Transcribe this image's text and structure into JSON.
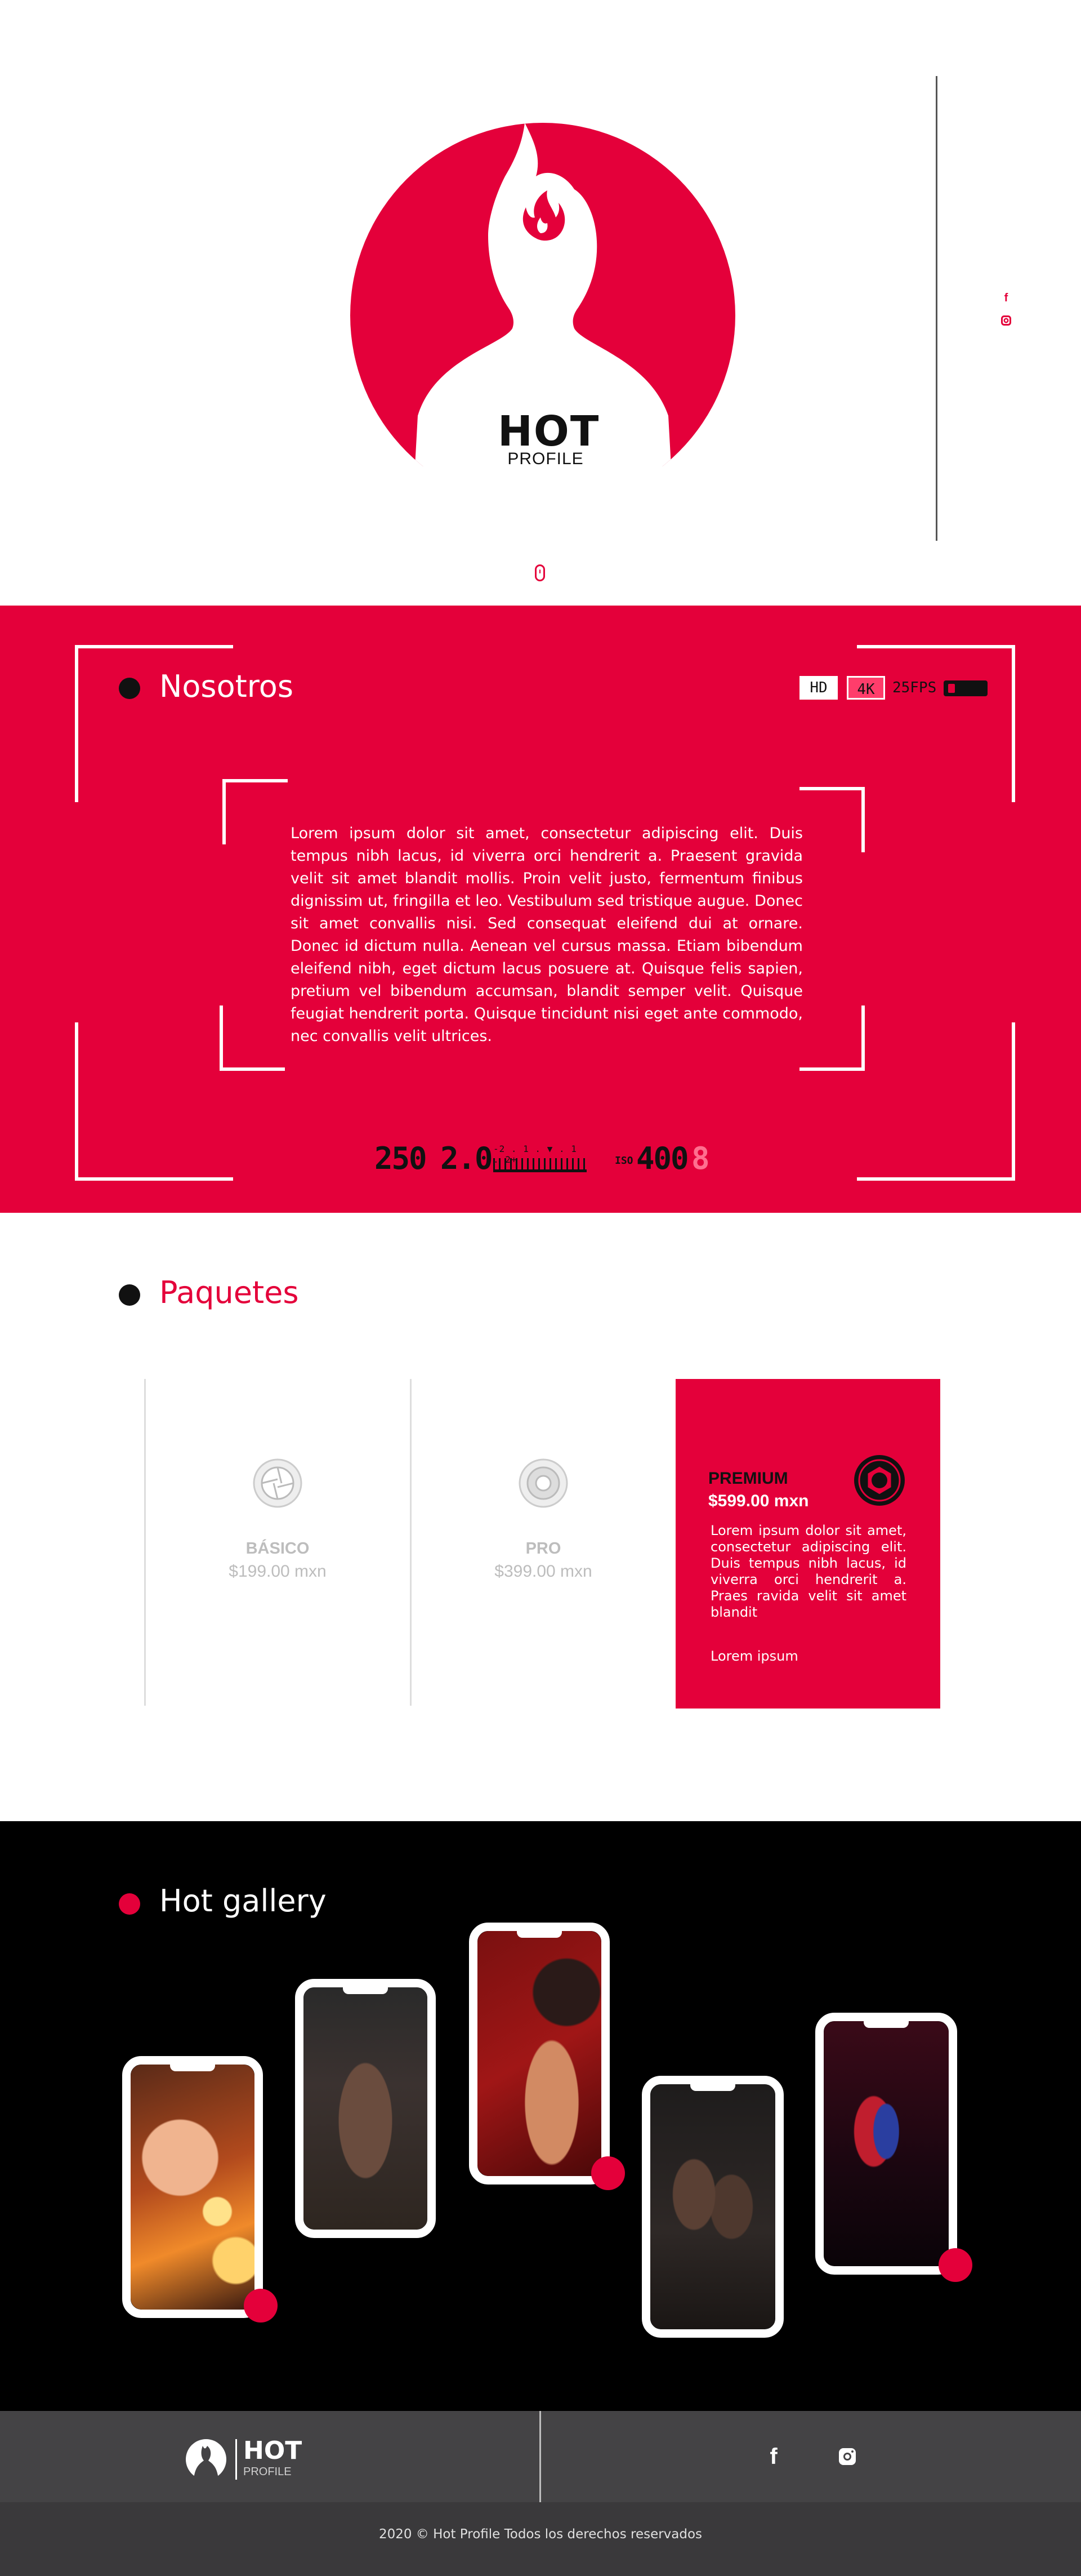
{
  "brand": {
    "name_main": "HOT",
    "name_sub": "PROFILE",
    "color_primary": "#e4003a",
    "color_dark": "#111111"
  },
  "hero": {
    "social_icons": [
      "facebook-icon",
      "instagram-icon"
    ],
    "scroll_icon": "mouse-scroll-icon"
  },
  "about": {
    "title": "Nosotros",
    "text": "Lorem ipsum dolor sit amet, consectetur adipiscing elit. Duis tempus nibh lacus, id viverra orci hendrerit a. Praesent gravida velit sit amet blandit mollis. Proin velit justo, fermentum finibus dignissim ut, fringilla et leo. Vestibulum sed tristique augue. Donec sit amet convallis nisi. Sed consequat eleifend dui at ornare. Donec id dictum nulla. Aenean vel cursus massa. Etiam bibendum eleifend nibh, eget dictum lacus posuere at. Quisque felis sapien, pretium vel bibendum accumsan, blandit semper velit. Quisque feugiat hendrerit porta. Quisque tincidunt nisi eget ante commodo, nec convallis velit ultrices.",
    "camera": {
      "badge_hd": "HD",
      "badge_4k": "4K",
      "fps": "25FPS",
      "shutter": "250",
      "aperture": "2.0",
      "exposure_scale": "-2 . 1 . ▼ . 1 . 2+",
      "iso_label": "ISO",
      "iso_value": "400",
      "iso_extra": "8"
    }
  },
  "packages": {
    "title": "Paquetes",
    "items": [
      {
        "name": "BÁSICO",
        "price": "$199.00 mxn",
        "icon": "aperture-icon"
      },
      {
        "name": "PRO",
        "price": "$399.00 mxn",
        "icon": "aperture-icon"
      },
      {
        "name": "PREMIUM",
        "price": "$599.00 mxn",
        "icon": "aperture-icon",
        "description": "Lorem ipsum dolor sit amet, consectetur adipiscing elit. Duis tempus nibh lacus, id viverra orci hendrerit a. Praes ravida velit sit amet blandit",
        "link": "Lorem ipsum"
      }
    ]
  },
  "gallery": {
    "title": "Hot gallery",
    "photos": [
      "photo-woman-lights",
      "photo-man-sunglasses",
      "photo-woman-profile",
      "photo-two-women",
      "photo-man-red-light"
    ]
  },
  "footer": {
    "logo_main": "HOT",
    "logo_sub": "PROFILE",
    "social_icons": [
      "facebook-icon",
      "instagram-icon"
    ],
    "copyright": "2020 © Hot Profile Todos los derechos reservados"
  }
}
